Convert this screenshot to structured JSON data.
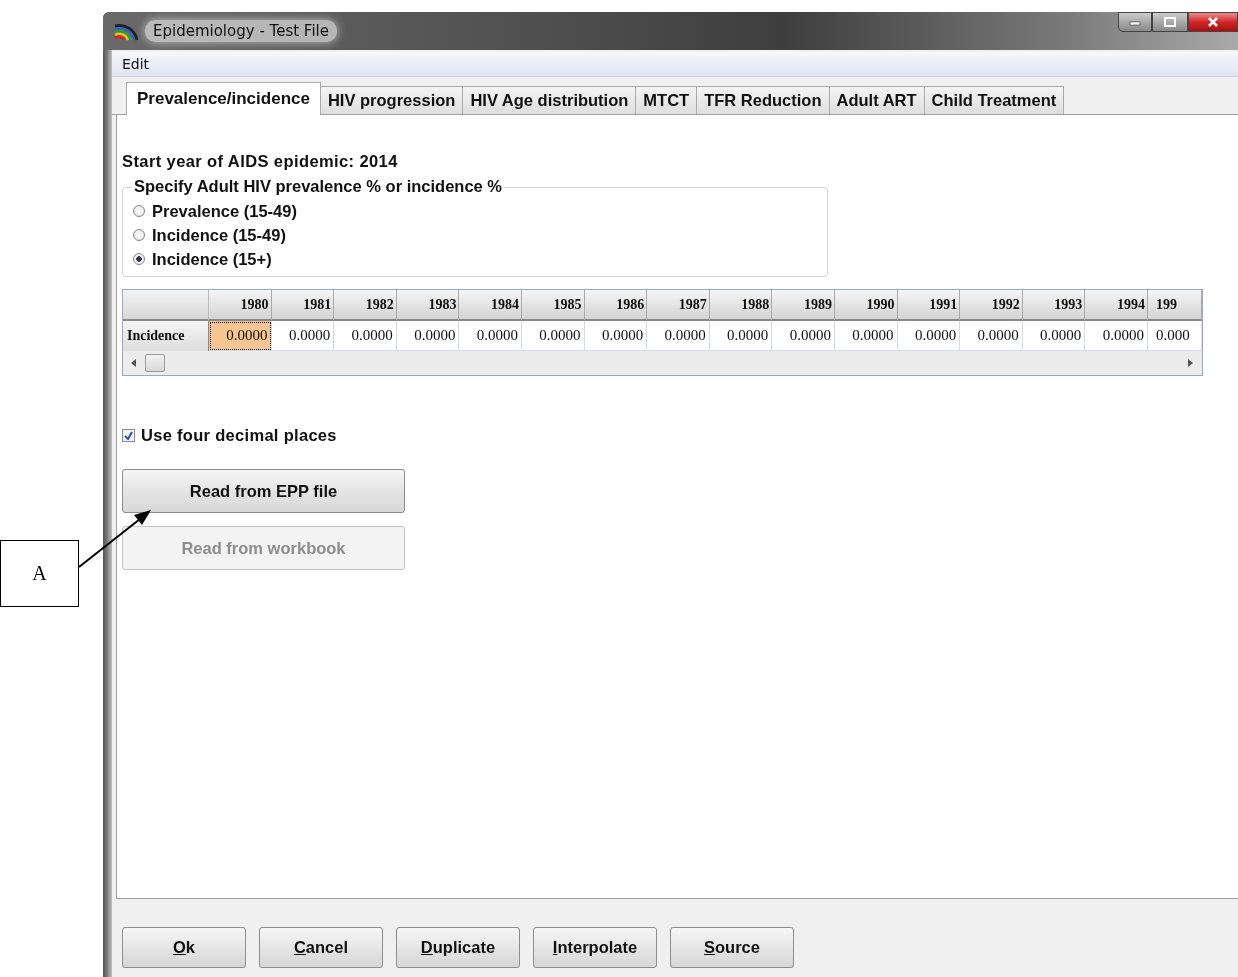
{
  "window": {
    "title": "Epidemiology - Test File"
  },
  "menu": [
    "Edit"
  ],
  "tabs": [
    {
      "label": "Prevalence/incidence",
      "selected": true
    },
    {
      "label": "HIV progression",
      "selected": false
    },
    {
      "label": "HIV Age distribution",
      "selected": false
    },
    {
      "label": "MTCT",
      "selected": false
    },
    {
      "label": "TFR Reduction",
      "selected": false
    },
    {
      "label": "Adult ART",
      "selected": false
    },
    {
      "label": "Child Treatment",
      "selected": false
    }
  ],
  "start_year_label": "Start year of AIDS epidemic: 2014",
  "specify_group": {
    "title": "Specify Adult HIV prevalence % or incidence %",
    "options": [
      {
        "label": "Prevalence (15-49)",
        "selected": false
      },
      {
        "label": "Incidence (15-49)",
        "selected": false
      },
      {
        "label": "Incidence (15+)",
        "selected": true
      }
    ]
  },
  "table": {
    "columns": [
      "1980",
      "1981",
      "1982",
      "1983",
      "1984",
      "1985",
      "1986",
      "1987",
      "1988",
      "1989",
      "1990",
      "1991",
      "1992",
      "1993",
      "1994",
      "199"
    ],
    "rows": [
      {
        "header": "Incidence",
        "cells": [
          {
            "value": "0.0000",
            "selected": true
          },
          {
            "value": "0.0000",
            "selected": false
          },
          {
            "value": "0.0000",
            "selected": false
          },
          {
            "value": "0.0000",
            "selected": false
          },
          {
            "value": "0.0000",
            "selected": false
          },
          {
            "value": "0.0000",
            "selected": false
          },
          {
            "value": "0.0000",
            "selected": false
          },
          {
            "value": "0.0000",
            "selected": false
          },
          {
            "value": "0.0000",
            "selected": false
          },
          {
            "value": "0.0000",
            "selected": false
          },
          {
            "value": "0.0000",
            "selected": false
          },
          {
            "value": "0.0000",
            "selected": false
          },
          {
            "value": "0.0000",
            "selected": false
          },
          {
            "value": "0.0000",
            "selected": false
          },
          {
            "value": "0.0000",
            "selected": false
          },
          {
            "value": "0.000",
            "selected": false
          }
        ]
      }
    ]
  },
  "decimal_checkbox": {
    "label": "Use four decimal places",
    "checked": true
  },
  "action_buttons": [
    {
      "label": "Read from EPP file",
      "disabled": false
    },
    {
      "label": "Read from workbook",
      "disabled": true
    }
  ],
  "callout": {
    "label": "A"
  },
  "footer_buttons": [
    {
      "label": "Ok",
      "mnemonic": true
    },
    {
      "label": "Cancel",
      "mnemonic": true
    },
    {
      "label": "Duplicate",
      "mnemonic": true
    },
    {
      "label": "Interpolate",
      "mnemonic": true
    },
    {
      "label": "Source",
      "mnemonic": true
    }
  ]
}
